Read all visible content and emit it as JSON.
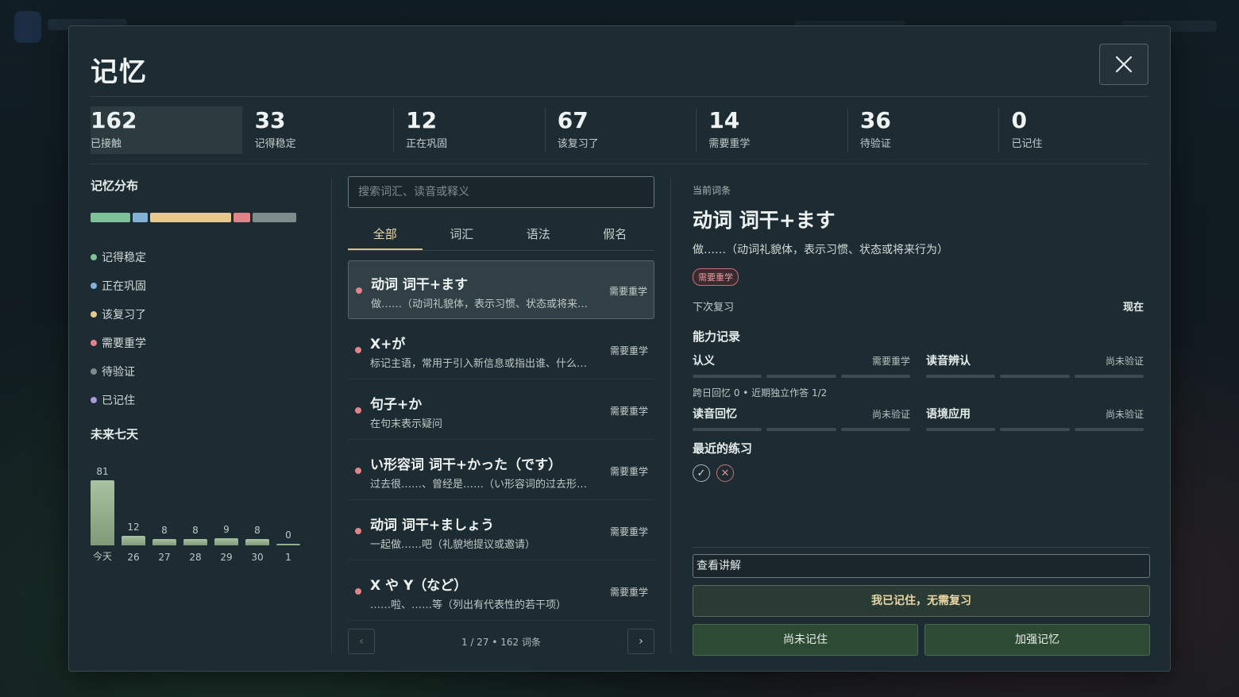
{
  "modal": {
    "title": "记忆"
  },
  "stats": [
    {
      "value": "162",
      "label": "已接触"
    },
    {
      "value": "33",
      "label": "记得稳定"
    },
    {
      "value": "12",
      "label": "正在巩固"
    },
    {
      "value": "67",
      "label": "该复习了"
    },
    {
      "value": "14",
      "label": "需要重学"
    },
    {
      "value": "36",
      "label": "待验证"
    },
    {
      "value": "0",
      "label": "已记住"
    }
  ],
  "distribution": {
    "title": "记忆分布",
    "segments": [
      {
        "label": "记得稳定",
        "count": 33,
        "color": "#7fc29a"
      },
      {
        "label": "正在巩固",
        "count": 12,
        "color": "#7fb2d6"
      },
      {
        "label": "该复习了",
        "count": 67,
        "color": "#e8c98a"
      },
      {
        "label": "需要重学",
        "count": 14,
        "color": "#e0848a"
      },
      {
        "label": "待验证",
        "count": 36,
        "color": "#7e8c8c"
      },
      {
        "label": "已记住",
        "count": 0,
        "color": "#a99ad6"
      }
    ]
  },
  "future": {
    "title": "未来七天",
    "days": [
      {
        "day": "今天",
        "value": 81
      },
      {
        "day": "26",
        "value": 12
      },
      {
        "day": "27",
        "value": 8
      },
      {
        "day": "28",
        "value": 8
      },
      {
        "day": "29",
        "value": 9
      },
      {
        "day": "30",
        "value": 8
      },
      {
        "day": "1",
        "value": 0
      }
    ]
  },
  "search": {
    "placeholder": "搜索词汇、读音或释义"
  },
  "tabs": [
    "全部",
    "词汇",
    "语法",
    "假名"
  ],
  "items": [
    {
      "title": "动词 词干+ます",
      "desc": "做……（动词礼貌体，表示习惯、状态或将来…",
      "status": "需要重学"
    },
    {
      "title": "X+が",
      "desc": "标记主语，常用于引入新信息或指出谁、什么…",
      "status": "需要重学"
    },
    {
      "title": "句子+か",
      "desc": "在句末表示疑问",
      "status": "需要重学"
    },
    {
      "title": "い形容词 词干+かった（です）",
      "desc": "过去很……、曾经是……（い形容词的过去形…",
      "status": "需要重学"
    },
    {
      "title": "动词 词干+ましょう",
      "desc": "一起做……吧（礼貌地提议或邀请）",
      "status": "需要重学"
    },
    {
      "title": "X や Y（など）",
      "desc": "……啦、……等（列出有代表性的若干项）",
      "status": "需要重学"
    }
  ],
  "pager": {
    "prev": "‹",
    "next": "›",
    "info": "1 / 27 • 162 词条"
  },
  "detail": {
    "label": "当前词条",
    "title": "动词 词干+ます",
    "desc": "做……（动词礼貌体，表示习惯、状态或将来行为）",
    "badge": "需要重学",
    "next_label": "下次复习",
    "next_value": "现在",
    "ability_title": "能力记录",
    "abilities": [
      {
        "name": "认义",
        "status": "需要重学",
        "note": "跨日回忆 0 • 近期独立作答 1/2"
      },
      {
        "name": "读音辨认",
        "status": "尚未验证"
      },
      {
        "name": "读音回忆",
        "status": "尚未验证"
      },
      {
        "name": "语境应用",
        "status": "尚未验证"
      }
    ],
    "recent_title": "最近的练习",
    "recent": [
      {
        "icon": "check-icon",
        "glyph": "✓"
      },
      {
        "icon": "cross-icon",
        "glyph": "✕"
      }
    ]
  },
  "actions": {
    "explain": "查看讲解",
    "remembered": "我已记住，无需复习",
    "not_remembered": "尚未记住",
    "reinforce": "加强记忆"
  }
}
